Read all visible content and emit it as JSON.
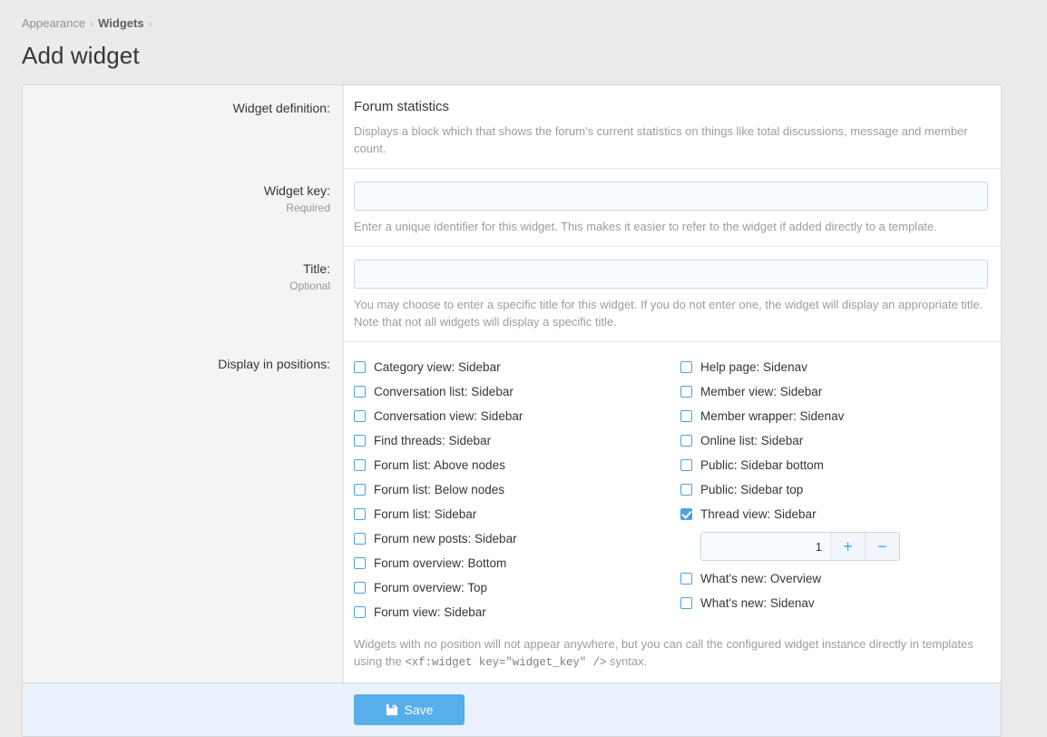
{
  "breadcrumb": {
    "items": [
      {
        "label": "Appearance",
        "strong": false
      },
      {
        "label": "Widgets",
        "strong": true
      }
    ],
    "separator": "›"
  },
  "page": {
    "title": "Add widget"
  },
  "form": {
    "definition": {
      "label": "Widget definition:",
      "name": "Forum statistics",
      "description": "Displays a block which that shows the forum's current statistics on things like total discussions, message and member count."
    },
    "widget_key": {
      "label": "Widget key:",
      "sub": "Required",
      "value": "",
      "placeholder": "",
      "hint": "Enter a unique identifier for this widget. This makes it easier to refer to the widget if added directly to a template."
    },
    "title": {
      "label": "Title:",
      "sub": "Optional",
      "value": "",
      "placeholder": "",
      "hint": "You may choose to enter a specific title for this widget. If you do not enter one, the widget will display an appropriate title. Note that not all widgets will display a specific title."
    },
    "positions": {
      "label": "Display in positions:",
      "column_left": [
        {
          "label": "Category view: Sidebar",
          "checked": false
        },
        {
          "label": "Conversation list: Sidebar",
          "checked": false
        },
        {
          "label": "Conversation view: Sidebar",
          "checked": false
        },
        {
          "label": "Find threads: Sidebar",
          "checked": false
        },
        {
          "label": "Forum list: Above nodes",
          "checked": false
        },
        {
          "label": "Forum list: Below nodes",
          "checked": false
        },
        {
          "label": "Forum list: Sidebar",
          "checked": false
        },
        {
          "label": "Forum new posts: Sidebar",
          "checked": false
        },
        {
          "label": "Forum overview: Bottom",
          "checked": false
        },
        {
          "label": "Forum overview: Top",
          "checked": false
        },
        {
          "label": "Forum view: Sidebar",
          "checked": false
        }
      ],
      "column_right": [
        {
          "label": "Help page: Sidenav",
          "checked": false
        },
        {
          "label": "Member view: Sidebar",
          "checked": false
        },
        {
          "label": "Member wrapper: Sidenav",
          "checked": false
        },
        {
          "label": "Online list: Sidebar",
          "checked": false
        },
        {
          "label": "Public: Sidebar bottom",
          "checked": false
        },
        {
          "label": "Public: Sidebar top",
          "checked": false
        },
        {
          "label": "Thread view: Sidebar",
          "checked": true
        },
        {
          "label": "What's new: Overview",
          "checked": false
        },
        {
          "label": "What's new: Sidenav",
          "checked": false
        }
      ],
      "stepper": {
        "value": "1",
        "increment_label": "+",
        "decrement_label": "−"
      },
      "note_before": "Widgets with no position will not appear anywhere, but you can call the configured widget instance directly in templates using the ",
      "note_code": "<xf:widget key=\"widget_key\" />",
      "note_after": " syntax."
    }
  },
  "footer": {
    "save_label": "Save"
  },
  "colors": {
    "accent": "#56aeea",
    "checkbox": "#4ba3e3",
    "page_bg": "#ebebeb",
    "label_bg": "#f4f4f4",
    "footer_bg": "#eaf2fb",
    "input_bg": "#f8fbfe"
  }
}
